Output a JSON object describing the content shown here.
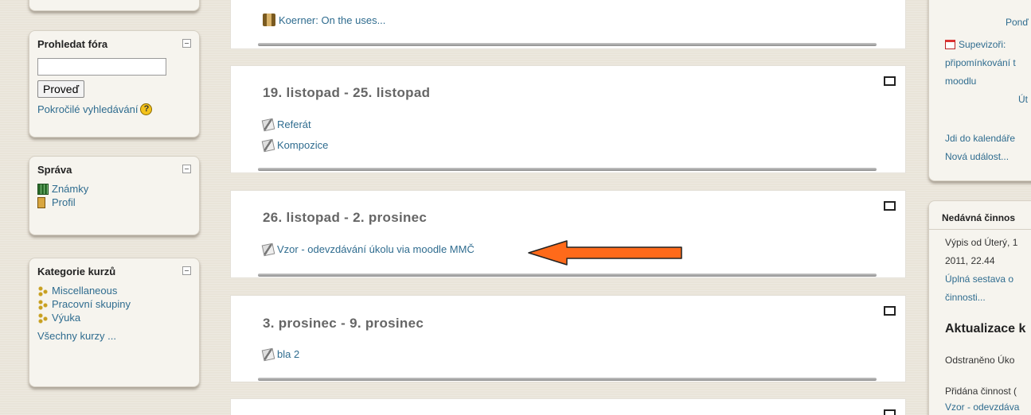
{
  "left": {
    "search": {
      "title": "Prohledat fóra",
      "input_value": "",
      "button": "Proveď",
      "advanced": "Pokročilé vyhledávání"
    },
    "admin": {
      "title": "Správa",
      "items": [
        {
          "label": "Známky",
          "icon": "grades-icon"
        },
        {
          "label": "Profil",
          "icon": "profile-icon"
        }
      ]
    },
    "categories": {
      "title": "Kategorie kurzů",
      "items": [
        {
          "label": "Miscellaneous",
          "icon": "category-icon"
        },
        {
          "label": "Pracovní skupiny",
          "icon": "category-icon"
        },
        {
          "label": "Výuka",
          "icon": "category-icon"
        }
      ],
      "all": "Všechny kurzy ..."
    }
  },
  "sections": [
    {
      "title": "",
      "activities": [
        "Koerner: On the uses..."
      ]
    },
    {
      "title": "19. listopad - 25. listopad",
      "activities": [
        "Referát",
        "Kompozice"
      ]
    },
    {
      "title": "26. listopad - 2. prosinec",
      "activities": [
        "Vzor - odevzdávání úkolu via moodle MMČ"
      ]
    },
    {
      "title": "3. prosinec - 9. prosinec",
      "activities": [
        "bla 2"
      ]
    }
  ],
  "right": {
    "calendar": {
      "day1": "Ponď",
      "event": "Supevizoři:",
      "event_line2": "připomínkování t",
      "event_line3": "moodlu",
      "day2": "Út",
      "goto": "Jdi do kalendáře",
      "new_event": "Nová událost..."
    },
    "recent": {
      "title": "Nedávná činnos",
      "since": "Výpis od Úterý, 1",
      "since2": "2011, 22.44",
      "full": "Úplná sestava o",
      "full2": "činnosti...",
      "updates": "Aktualizace k",
      "removed": "Odstraněno Úko",
      "added": "Přidána činnost (",
      "added_link": "Vzor - odevzdáva"
    }
  },
  "colors": {
    "link": "#2f6c8f",
    "arrow": "#ff6a1a"
  }
}
